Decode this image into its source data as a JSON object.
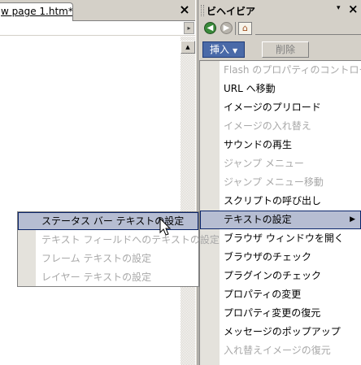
{
  "document": {
    "tab_label": "w page 1.htm*",
    "close_symbol": "×",
    "arrow_symbol": "▸",
    "scroll_up_symbol": "▲"
  },
  "panel": {
    "title": "ビヘイビア",
    "menu_symbol": "▾",
    "close_symbol": "×",
    "nav": {
      "back_symbol": "◀",
      "forward_symbol": "▶",
      "home_symbol": "⌂"
    },
    "insert_label": "挿入",
    "insert_arrow": "▼",
    "delete_label": "削除"
  },
  "menu": {
    "items": [
      {
        "label": "Flash のプロパティのコントロール",
        "enabled": false
      },
      {
        "label": "URL へ移動",
        "enabled": true
      },
      {
        "label": "イメージのプリロード",
        "enabled": true
      },
      {
        "label": "イメージの入れ替え",
        "enabled": false
      },
      {
        "label": "サウンドの再生",
        "enabled": true
      },
      {
        "label": "ジャンプ メニュー",
        "enabled": false
      },
      {
        "label": "ジャンプ メニュー移動",
        "enabled": false
      },
      {
        "label": "スクリプトの呼び出し",
        "enabled": true
      },
      {
        "label": "テキストの設定",
        "enabled": true,
        "selected": true,
        "submenu_arrow": "▶"
      },
      {
        "label": "ブラウザ ウィンドウを開く",
        "enabled": true
      },
      {
        "label": "ブラウザのチェック",
        "enabled": true
      },
      {
        "label": "プラグインのチェック",
        "enabled": true
      },
      {
        "label": "プロパティの変更",
        "enabled": true
      },
      {
        "label": "プロパティ変更の復元",
        "enabled": true
      },
      {
        "label": "メッセージのポップアップ",
        "enabled": true
      },
      {
        "label": "入れ替えイメージの復元",
        "enabled": false
      }
    ]
  },
  "submenu": {
    "items": [
      {
        "label": "ステータス バー テキストの設定",
        "enabled": true,
        "selected": true
      },
      {
        "label": "テキスト フィールドへのテキストの設定",
        "enabled": false
      },
      {
        "label": "フレーム テキストの設定",
        "enabled": false
      },
      {
        "label": "レイヤー テキストの設定",
        "enabled": false
      }
    ]
  },
  "colors": {
    "chrome": "#d4d0c8",
    "selection_fill": "#b6bdd2",
    "selection_border": "#0a246a",
    "insert_button": "#4a6aa8",
    "disabled_text": "#a8a8a8"
  }
}
